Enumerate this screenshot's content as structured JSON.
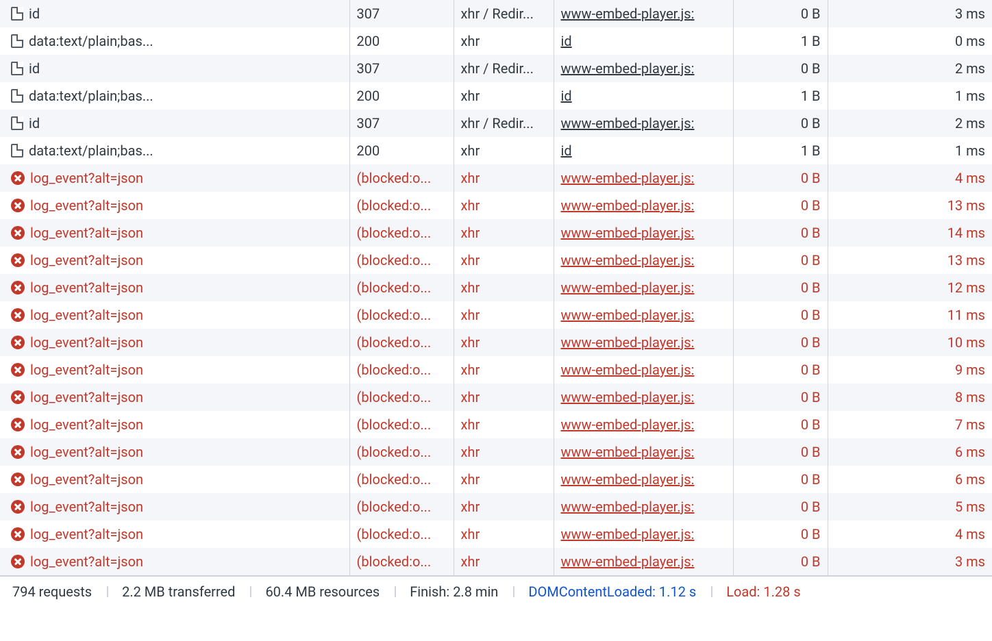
{
  "rows": [
    {
      "error": false,
      "name": "id",
      "status": "307",
      "type": "xhr / Redir...",
      "initiator": "www-embed-player.js:",
      "size": "0 B",
      "time": "3 ms"
    },
    {
      "error": false,
      "name": "data:text/plain;bas...",
      "status": "200",
      "type": "xhr",
      "initiator": "id",
      "size": "1 B",
      "time": "0 ms"
    },
    {
      "error": false,
      "name": "id",
      "status": "307",
      "type": "xhr / Redir...",
      "initiator": "www-embed-player.js:",
      "size": "0 B",
      "time": "2 ms"
    },
    {
      "error": false,
      "name": "data:text/plain;bas...",
      "status": "200",
      "type": "xhr",
      "initiator": "id",
      "size": "1 B",
      "time": "1 ms"
    },
    {
      "error": false,
      "name": "id",
      "status": "307",
      "type": "xhr / Redir...",
      "initiator": "www-embed-player.js:",
      "size": "0 B",
      "time": "2 ms"
    },
    {
      "error": false,
      "name": "data:text/plain;bas...",
      "status": "200",
      "type": "xhr",
      "initiator": "id",
      "size": "1 B",
      "time": "1 ms"
    },
    {
      "error": true,
      "name": "log_event?alt=json",
      "status": "(blocked:o...",
      "type": "xhr",
      "initiator": "www-embed-player.js:",
      "size": "0 B",
      "time": "4 ms"
    },
    {
      "error": true,
      "name": "log_event?alt=json",
      "status": "(blocked:o...",
      "type": "xhr",
      "initiator": "www-embed-player.js:",
      "size": "0 B",
      "time": "13 ms"
    },
    {
      "error": true,
      "name": "log_event?alt=json",
      "status": "(blocked:o...",
      "type": "xhr",
      "initiator": "www-embed-player.js:",
      "size": "0 B",
      "time": "14 ms"
    },
    {
      "error": true,
      "name": "log_event?alt=json",
      "status": "(blocked:o...",
      "type": "xhr",
      "initiator": "www-embed-player.js:",
      "size": "0 B",
      "time": "13 ms"
    },
    {
      "error": true,
      "name": "log_event?alt=json",
      "status": "(blocked:o...",
      "type": "xhr",
      "initiator": "www-embed-player.js:",
      "size": "0 B",
      "time": "12 ms"
    },
    {
      "error": true,
      "name": "log_event?alt=json",
      "status": "(blocked:o...",
      "type": "xhr",
      "initiator": "www-embed-player.js:",
      "size": "0 B",
      "time": "11 ms"
    },
    {
      "error": true,
      "name": "log_event?alt=json",
      "status": "(blocked:o...",
      "type": "xhr",
      "initiator": "www-embed-player.js:",
      "size": "0 B",
      "time": "10 ms"
    },
    {
      "error": true,
      "name": "log_event?alt=json",
      "status": "(blocked:o...",
      "type": "xhr",
      "initiator": "www-embed-player.js:",
      "size": "0 B",
      "time": "9 ms"
    },
    {
      "error": true,
      "name": "log_event?alt=json",
      "status": "(blocked:o...",
      "type": "xhr",
      "initiator": "www-embed-player.js:",
      "size": "0 B",
      "time": "8 ms"
    },
    {
      "error": true,
      "name": "log_event?alt=json",
      "status": "(blocked:o...",
      "type": "xhr",
      "initiator": "www-embed-player.js:",
      "size": "0 B",
      "time": "7 ms"
    },
    {
      "error": true,
      "name": "log_event?alt=json",
      "status": "(blocked:o...",
      "type": "xhr",
      "initiator": "www-embed-player.js:",
      "size": "0 B",
      "time": "6 ms"
    },
    {
      "error": true,
      "name": "log_event?alt=json",
      "status": "(blocked:o...",
      "type": "xhr",
      "initiator": "www-embed-player.js:",
      "size": "0 B",
      "time": "6 ms"
    },
    {
      "error": true,
      "name": "log_event?alt=json",
      "status": "(blocked:o...",
      "type": "xhr",
      "initiator": "www-embed-player.js:",
      "size": "0 B",
      "time": "5 ms"
    },
    {
      "error": true,
      "name": "log_event?alt=json",
      "status": "(blocked:o...",
      "type": "xhr",
      "initiator": "www-embed-player.js:",
      "size": "0 B",
      "time": "4 ms"
    },
    {
      "error": true,
      "name": "log_event?alt=json",
      "status": "(blocked:o...",
      "type": "xhr",
      "initiator": "www-embed-player.js:",
      "size": "0 B",
      "time": "3 ms"
    }
  ],
  "status": {
    "requests": "794 requests",
    "transferred": "2.2 MB transferred",
    "resources": "60.4 MB resources",
    "finish": "Finish: 2.8 min",
    "domcontentloaded": "DOMContentLoaded: 1.12 s",
    "load": "Load: 1.28 s"
  }
}
